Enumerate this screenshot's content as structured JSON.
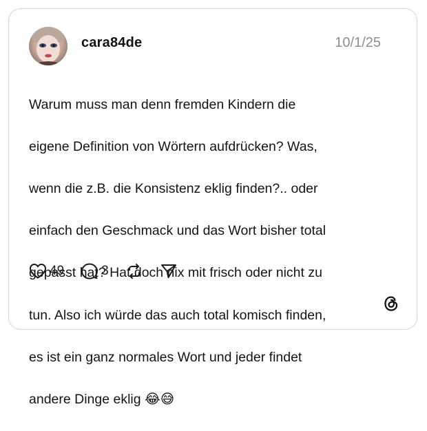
{
  "post": {
    "username": "cara84de",
    "date": "10/1/25",
    "text_lines": [
      "Warum muss man denn fremden Kindern die",
      "eigene Definition von Wörtern aufdrücken? Was,",
      "wenn die z.B. die Konsistenz eklig finden?.. oder",
      "einfach den Geschmack und das Wort bisher total",
      "gepasst hat? Hat doch nix mit frisch oder nicht zu",
      "tun. Also ich würde das auch total komisch finden,",
      "es ist ein ganz normales Wort und jeder findet"
    ],
    "last_line_text": "andere Dinge eklig ",
    "last_line_emojis": "😂😅",
    "likes": "49",
    "replies": "3"
  },
  "icons": {
    "like": "heart-icon",
    "reply": "comment-bubble-icon",
    "repost": "repost-icon",
    "share": "send-icon",
    "brand": "threads-logo-icon"
  },
  "colors": {
    "border": "#d6d6d6",
    "date": "#8e8e8e",
    "text": "#141414"
  }
}
